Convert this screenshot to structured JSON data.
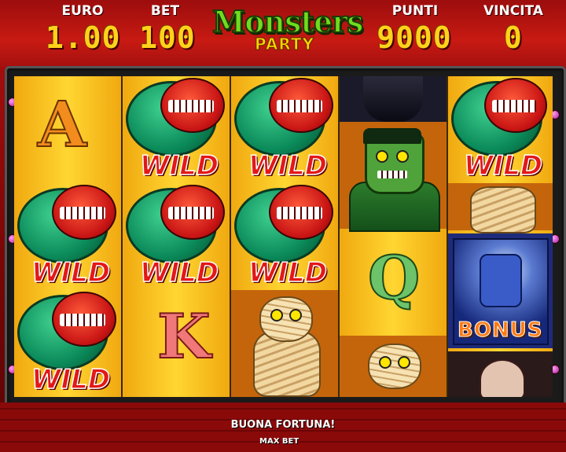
{
  "header": {
    "euro_label": "EURO",
    "euro_value": "1.00",
    "bet_label": "BET",
    "bet_value": "100",
    "punti_label": "PUNTI",
    "punti_value": "9000",
    "vincita_label": "VINCITA",
    "vincita_value": "0"
  },
  "logo": {
    "title": "Monsters",
    "subtitle": "PARTY"
  },
  "reels": {
    "wild_label": "WILD",
    "bonus_label": "BONUS",
    "letter_a": "A",
    "letter_k": "K",
    "letter_q": "Q"
  },
  "footer": {
    "status": "BUONA FORTUNA!",
    "max_bet": "MAX BET"
  },
  "colors": {
    "reel_background": "#f7c21e",
    "header_value": "#ffd21a",
    "wild_text": "#e41818",
    "logo_green": "#6fdc1e"
  }
}
